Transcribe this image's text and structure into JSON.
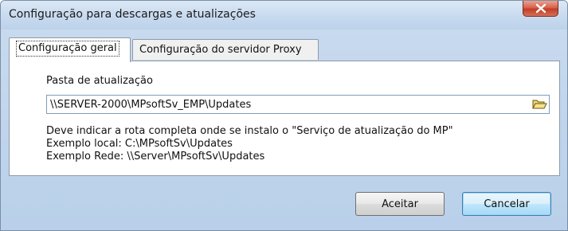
{
  "window": {
    "title": "Configuração para descargas e atualizações"
  },
  "tabs": [
    {
      "label": "Configuração geral",
      "active": true
    },
    {
      "label": "Configuração do servidor Proxy",
      "active": false
    }
  ],
  "general": {
    "folder_label": "Pasta de atualização",
    "folder_value": "\\\\SERVER-2000\\MPsoftSv_EMP\\Updates",
    "hint_lines": [
      "Deve indicar a rota completa onde se instalo o \"Serviço de atualização do MP\"",
      "Exemplo local: C:\\MPsoftSv\\Updates",
      "Exemplo Rede: \\\\Server\\MPsoftSv\\Updates"
    ]
  },
  "buttons": {
    "accept_label": "Aceitar",
    "cancel_label": "Cancelar"
  },
  "icons": {
    "close": "close-icon",
    "browse": "folder-icon"
  }
}
